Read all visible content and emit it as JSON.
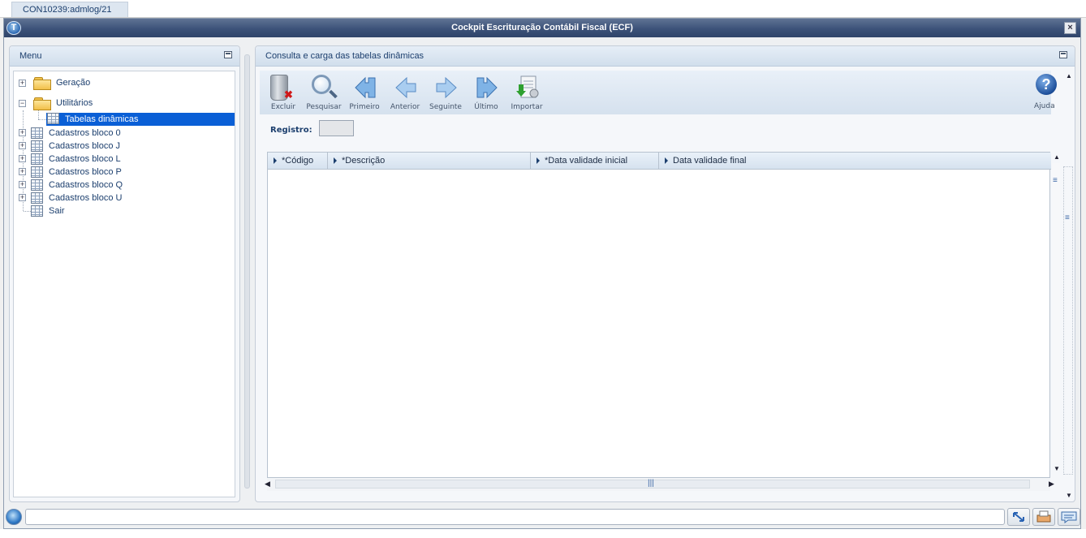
{
  "tab": {
    "label": "CON10239:admlog/21"
  },
  "window": {
    "title": "Cockpit Escrituração Contábil Fiscal (ECF)"
  },
  "menu": {
    "title": "Menu",
    "items": [
      {
        "label": "Geração",
        "type": "folder",
        "expander": "+"
      },
      {
        "label": "Utilitários",
        "type": "folder",
        "expander": "−"
      },
      {
        "label": "Tabelas dinâmicas",
        "type": "grid",
        "selected": true
      },
      {
        "label": "Cadastros bloco 0",
        "type": "grid",
        "expander": "+"
      },
      {
        "label": "Cadastros bloco J",
        "type": "grid",
        "expander": "+"
      },
      {
        "label": "Cadastros bloco L",
        "type": "grid",
        "expander": "+"
      },
      {
        "label": "Cadastros bloco P",
        "type": "grid",
        "expander": "+"
      },
      {
        "label": "Cadastros bloco Q",
        "type": "grid",
        "expander": "+"
      },
      {
        "label": "Cadastros bloco U",
        "type": "grid",
        "expander": "+"
      },
      {
        "label": "Sair",
        "type": "grid"
      }
    ]
  },
  "content": {
    "title": "Consulta e carga das tabelas dinâmicas",
    "toolbar": {
      "excluir": "Excluir",
      "pesquisar": "Pesquisar",
      "primeiro": "Primeiro",
      "anterior": "Anterior",
      "seguinte": "Seguinte",
      "ultimo": "Último",
      "importar": "Importar",
      "ajuda": "Ajuda"
    },
    "registro_label": "Registro:",
    "registro_value": "",
    "grid": {
      "columns": [
        "*Código",
        "*Descrição",
        "*Data validade inicial",
        "Data validade final"
      ],
      "rows": []
    }
  },
  "colors": {
    "titlebar": "#3c5279",
    "selection": "#0a5fd6",
    "accent_text": "#1c3f6e"
  }
}
